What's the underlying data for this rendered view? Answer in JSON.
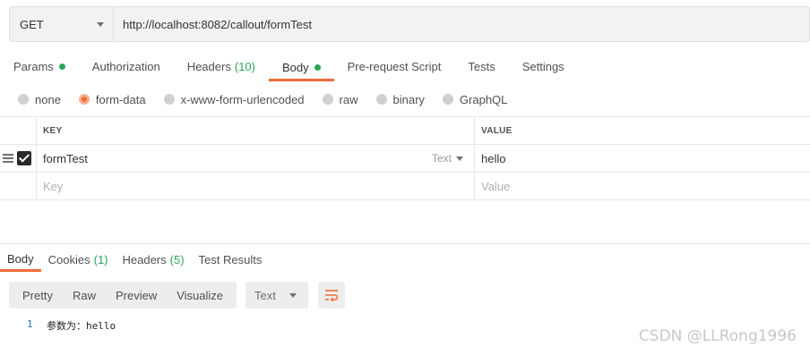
{
  "request": {
    "method": "GET",
    "url": "http://localhost:8082/callout/formTest"
  },
  "request_tabs": [
    {
      "label": "Params",
      "dot": true
    },
    {
      "label": "Authorization"
    },
    {
      "label": "Headers",
      "count": "(10)"
    },
    {
      "label": "Body",
      "dot": true,
      "active": true
    },
    {
      "label": "Pre-request Script"
    },
    {
      "label": "Tests"
    },
    {
      "label": "Settings"
    }
  ],
  "body_types": [
    {
      "label": "none",
      "selected": false
    },
    {
      "label": "form-data",
      "selected": true
    },
    {
      "label": "x-www-form-urlencoded",
      "selected": false
    },
    {
      "label": "raw",
      "selected": false
    },
    {
      "label": "binary",
      "selected": false
    },
    {
      "label": "GraphQL",
      "selected": false
    }
  ],
  "params_table": {
    "key_header": "KEY",
    "value_header": "VALUE",
    "rows": [
      {
        "key": "formTest",
        "type": "Text",
        "value": "hello",
        "checked": true
      }
    ],
    "key_placeholder": "Key",
    "value_placeholder": "Value"
  },
  "response_tabs": [
    {
      "label": "Body",
      "active": true
    },
    {
      "label": "Cookies",
      "count": "(1)"
    },
    {
      "label": "Headers",
      "count": "(5)"
    },
    {
      "label": "Test Results"
    }
  ],
  "view_modes": [
    "Pretty",
    "Raw",
    "Preview",
    "Visualize"
  ],
  "format_select": "Text",
  "response_body": {
    "line_number": "1",
    "content": "参数为：hello"
  },
  "watermark": "CSDN @LLRong1996",
  "colors": {
    "accent": "#f26b3a",
    "dot_green": "#26a65b"
  }
}
